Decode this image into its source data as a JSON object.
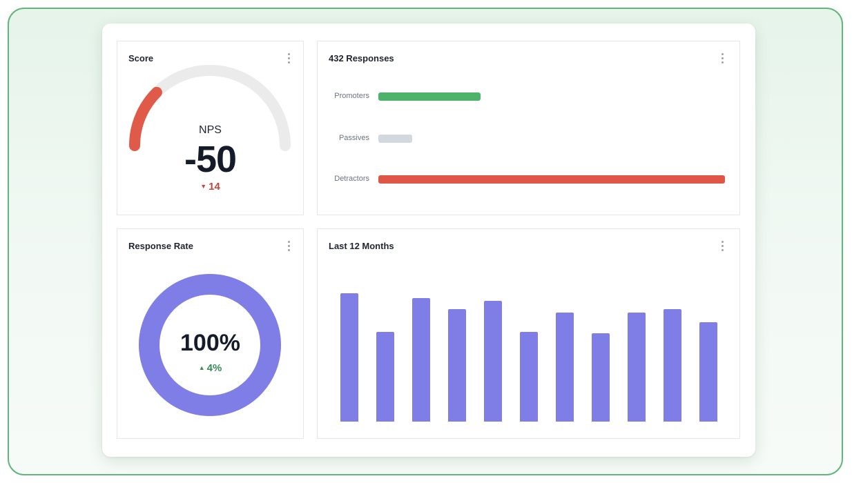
{
  "score": {
    "title": "Score",
    "label": "NPS",
    "value": "-50",
    "change": "14",
    "change_direction": "down",
    "gauge_fill": 0.25,
    "colors": {
      "fill": "#e05a4a",
      "track": "#ebebeb"
    }
  },
  "responses": {
    "title": "432 Responses",
    "rows": [
      {
        "label": "Promoters",
        "fraction": 0.295,
        "color": "#4db36a"
      },
      {
        "label": "Passives",
        "fraction": 0.097,
        "color": "#d3d8df"
      },
      {
        "label": "Detractors",
        "fraction": 1.0,
        "color": "#df5647"
      }
    ]
  },
  "rate": {
    "title": "Response Rate",
    "value": "100%",
    "change": "4%",
    "change_direction": "up",
    "ring_fill": 1.0,
    "color": "#7e7ee6"
  },
  "months": {
    "title": "Last 12 Months",
    "color": "#7e7ee6",
    "relative_values": [
      0.8,
      0.56,
      0.77,
      0.7,
      0.75,
      0.56,
      0.68,
      0.55,
      0.68,
      0.7,
      0.62
    ]
  },
  "menu_icon": "kebab-menu-icon"
}
